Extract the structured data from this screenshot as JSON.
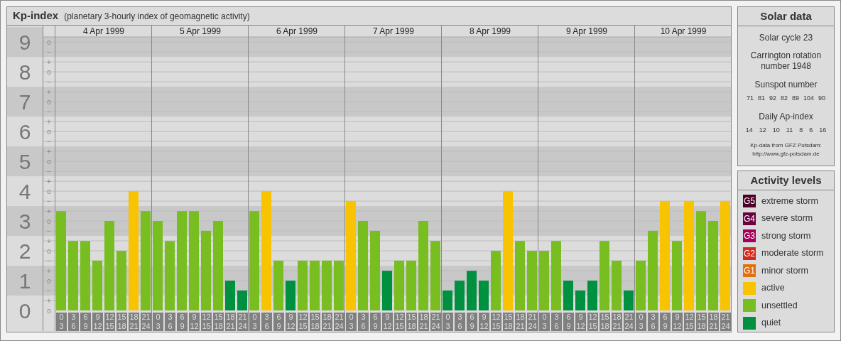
{
  "kp_chart": {
    "title": "Kp-index",
    "subtitle": "(planetary 3-hourly index of geomagnetic activity)",
    "days": [
      "4 Apr 1999",
      "5 Apr 1999",
      "6 Apr 1999",
      "7 Apr 1999",
      "8 Apr 1999",
      "9 Apr 1999",
      "10 Apr 1999"
    ],
    "subdivision_marks": [
      "o",
      "−",
      "+",
      "o",
      "−",
      "+",
      "o",
      "−",
      "+",
      "o",
      "−",
      "+",
      "o",
      "−",
      "+",
      "o",
      "−",
      "+",
      "o",
      "−",
      "+",
      "o",
      "−",
      "+",
      "o",
      "−",
      "+",
      "o"
    ],
    "chart_data": {
      "type": "bar",
      "stacked": true,
      "grid": true,
      "ylim": [
        0,
        9.17
      ],
      "yticks": [
        0,
        1,
        2,
        3,
        4,
        5,
        6,
        7,
        8,
        9
      ],
      "categories": [
        "0 3",
        "3 6",
        "6 9",
        "9 12",
        "12 15",
        "15 18",
        "18 21",
        "21 24",
        "0 3",
        "3 6",
        "6 9",
        "9 12",
        "12 15",
        "15 18",
        "18 21",
        "21 24",
        "0 3",
        "3 6",
        "6 9",
        "9 12",
        "12 15",
        "15 18",
        "18 21",
        "21 24",
        "0 3",
        "3 6",
        "6 9",
        "9 12",
        "12 15",
        "15 18",
        "18 21",
        "21 24",
        "0 3",
        "3 6",
        "6 9",
        "9 12",
        "12 15",
        "15 18",
        "18 21",
        "21 24",
        "0 3",
        "3 6",
        "6 9",
        "9 12",
        "12 15",
        "15 18",
        "18 21",
        "21 24",
        "0 3",
        "3 6",
        "6 9",
        "9 12",
        "12 15",
        "15 18",
        "18 21",
        "21 24"
      ],
      "series": [
        {
          "color": "#009140",
          "values": [
            null,
            null,
            null,
            null,
            null,
            null,
            null,
            null,
            null,
            null,
            null,
            null,
            null,
            null,
            1,
            0.67,
            null,
            null,
            null,
            1,
            null,
            null,
            null,
            null,
            null,
            null,
            null,
            1.33,
            null,
            null,
            null,
            null,
            0.67,
            1,
            1.33,
            1,
            null,
            null,
            null,
            null,
            null,
            null,
            1,
            0.67,
            1,
            null,
            null,
            0.67,
            null,
            null,
            null,
            null,
            null,
            null,
            null,
            null
          ]
        },
        {
          "color": "#78be20",
          "values": [
            3.33,
            2.33,
            2.33,
            1.67,
            3,
            2,
            null,
            3.33,
            3,
            2.33,
            3.33,
            3.33,
            2.67,
            3,
            null,
            null,
            3.33,
            null,
            1.67,
            null,
            1.67,
            1.67,
            1.67,
            1.67,
            null,
            3,
            2.67,
            null,
            1.67,
            1.67,
            3,
            2.33,
            null,
            null,
            null,
            null,
            2,
            null,
            2.33,
            2,
            2,
            2.33,
            null,
            null,
            null,
            2.33,
            1.67,
            null,
            1.67,
            2.67,
            null,
            2.33,
            null,
            3.33,
            3,
            null
          ]
        },
        {
          "color": "#f8c300",
          "values": [
            null,
            null,
            null,
            null,
            null,
            null,
            4,
            null,
            null,
            null,
            null,
            null,
            null,
            null,
            null,
            null,
            null,
            4,
            null,
            null,
            null,
            null,
            null,
            null,
            3.67,
            null,
            null,
            null,
            null,
            null,
            null,
            null,
            null,
            null,
            null,
            null,
            null,
            4,
            null,
            null,
            null,
            null,
            null,
            null,
            null,
            null,
            null,
            null,
            null,
            null,
            3.67,
            null,
            3.67,
            null,
            null,
            3.67
          ]
        }
      ]
    }
  },
  "solar_data": {
    "title": "Solar data",
    "solar_cycle": "Solar cycle 23",
    "carrington": "Carrington rotation number 1948",
    "sunspot_label": "Sunspot number",
    "sunspot_numbers": [
      "71",
      "81",
      "92",
      "82",
      "89",
      "104",
      "90"
    ],
    "ap_label": "Daily Ap-index",
    "ap_values": [
      "14",
      "12",
      "10",
      "11",
      "8",
      "6",
      "16"
    ],
    "credit": "Kp-data from GFZ Potsdam:",
    "credit_url": "http://www.gfz-potsdam.de"
  },
  "activity_levels": {
    "title": "Activity levels",
    "items": [
      {
        "badge": "G5",
        "label": "extreme storm",
        "color": "#4d0026"
      },
      {
        "badge": "G4",
        "label": "severe storm",
        "color": "#6b0040"
      },
      {
        "badge": "G3",
        "label": "strong storm",
        "color": "#a3005a"
      },
      {
        "badge": "G2",
        "label": "moderate storm",
        "color": "#d42a1e"
      },
      {
        "badge": "G1",
        "label": "minor storm",
        "color": "#e07010"
      },
      {
        "label": "active",
        "color": "#f8c300"
      },
      {
        "label": "unsettled",
        "color": "#78be20"
      },
      {
        "label": "quiet",
        "color": "#009140"
      }
    ]
  }
}
